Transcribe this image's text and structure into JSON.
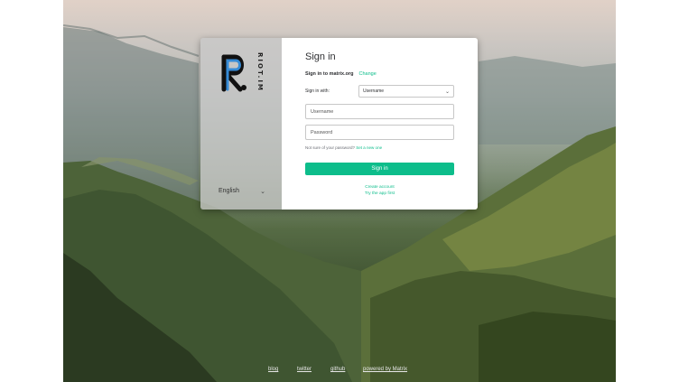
{
  "colors": {
    "accent": "#0dbd8b",
    "text": "#2e2f32",
    "brand_panel": "#c8c8c8"
  },
  "brand": {
    "logo_icon": "riot-r-logo-icon",
    "logo_text": "RIOT.IM"
  },
  "language": {
    "selected": "English",
    "icon": "chevron-down-icon"
  },
  "form": {
    "title": "Sign in",
    "server_label": "Sign in to matrix.org",
    "change_link": "Change",
    "sign_in_with_label": "Sign in with:",
    "sign_in_with_value": "Username",
    "username_placeholder": "Username",
    "password_placeholder": "Password",
    "forgot_text": "Not sure of your password?",
    "forgot_link": "Set a new one",
    "submit_label": "Sign in",
    "create_account": "Create account",
    "try_app": "Try the app first"
  },
  "footer": {
    "links": [
      "blog",
      "twitter",
      "github",
      "powered by Matrix"
    ]
  }
}
